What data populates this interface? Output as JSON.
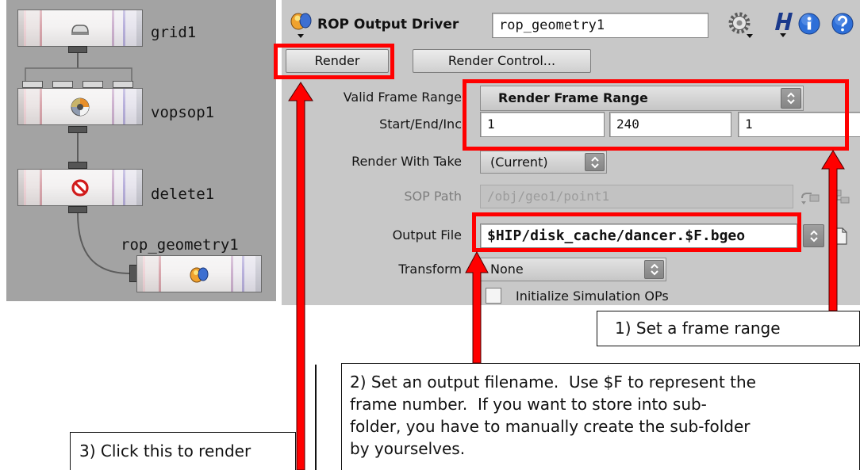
{
  "network_editor": {
    "nodes": [
      {
        "name": "grid1",
        "icon": "grid-icon"
      },
      {
        "name": "vopsop1",
        "icon": "vop-icon"
      },
      {
        "name": "delete1",
        "icon": "delete-icon"
      },
      {
        "name": "rop_geometry1",
        "icon": "rop-icon"
      }
    ]
  },
  "parameter_editor": {
    "header": {
      "type_icon": "rop-output-icon",
      "type_label": "ROP Output Driver",
      "node_name": "rop_geometry1",
      "icons": [
        "gear-icon",
        "houdini-h-icon",
        "info-icon",
        "help-icon"
      ]
    },
    "buttons": {
      "render": "Render",
      "render_control": "Render Control..."
    },
    "parameters": {
      "valid_frame_range": {
        "label": "Valid Frame Range",
        "value": "Render Frame Range"
      },
      "start_end_inc": {
        "label": "Start/End/Inc",
        "start": "1",
        "end": "240",
        "inc": "1"
      },
      "render_with_take": {
        "label": "Render With Take",
        "value": "(Current)"
      },
      "sop_path": {
        "label": "SOP Path",
        "value": "/obj/geo1/point1",
        "enabled": false
      },
      "output_file": {
        "label": "Output File",
        "value": "$HIP/disk_cache/dancer.$F.bgeo"
      },
      "transform": {
        "label": "Transform",
        "value": "None"
      },
      "initialize_simulation_ops": {
        "label": "Initialize Simulation OPs",
        "checked": false
      }
    }
  },
  "annotations": {
    "highlight_color": "#ff0000",
    "callout_frame_range": {
      "lines": [
        "1) Set a frame range"
      ]
    },
    "callout_output_file": {
      "lines": [
        "2) Set an output filename.  Use $F to represent the",
        "frame number.  If you want to store into sub-",
        "folder, you have to manually create the sub-folder",
        "by yourselves."
      ]
    },
    "callout_render": {
      "lines": [
        "3) Click this to render"
      ]
    }
  }
}
